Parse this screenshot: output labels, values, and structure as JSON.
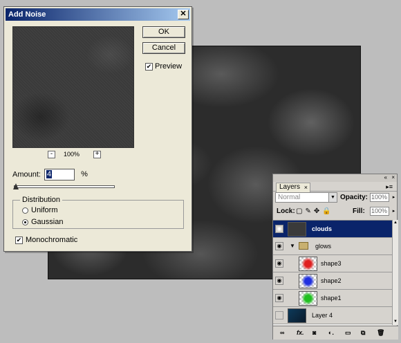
{
  "dialog": {
    "title": "Add Noise",
    "close_glyph": "✕",
    "ok_label": "OK",
    "cancel_label": "Cancel",
    "preview_label": "Preview",
    "preview_checked": true,
    "zoom_out": "-",
    "zoom_level": "100%",
    "zoom_in": "+",
    "amount_label": "Amount:",
    "amount_value": "4",
    "amount_unit": "%",
    "amount_slider_fraction": 0.04,
    "distribution_label": "Distribution",
    "distribution_options": [
      "Uniform",
      "Gaussian"
    ],
    "distribution_selected": "Gaussian",
    "monochromatic_label": "Monochromatic",
    "monochromatic_checked": true
  },
  "layers_panel": {
    "tab_label": "Layers",
    "tab_close": "×",
    "blend_mode": "Normal",
    "opacity_label": "Opacity:",
    "opacity_value": "100%",
    "lock_label": "Lock:",
    "fill_label": "Fill:",
    "fill_value": "100%",
    "layers": [
      {
        "name": "clouds",
        "visible": true,
        "selected": true,
        "type": "layer"
      },
      {
        "name": "glows",
        "visible": true,
        "selected": false,
        "type": "group"
      },
      {
        "name": "shape3",
        "visible": true,
        "selected": false,
        "type": "layer",
        "color": "#e02020"
      },
      {
        "name": "shape2",
        "visible": true,
        "selected": false,
        "type": "layer",
        "color": "#2030e0"
      },
      {
        "name": "shape1",
        "visible": true,
        "selected": false,
        "type": "layer",
        "color": "#20c020"
      },
      {
        "name": "Layer 4",
        "visible": false,
        "selected": false,
        "type": "layer"
      }
    ],
    "bottom_icons": [
      "link-icon",
      "fx-icon",
      "mask-icon",
      "adjustment-icon",
      "folder-icon",
      "new-layer-icon",
      "trash-icon"
    ]
  }
}
